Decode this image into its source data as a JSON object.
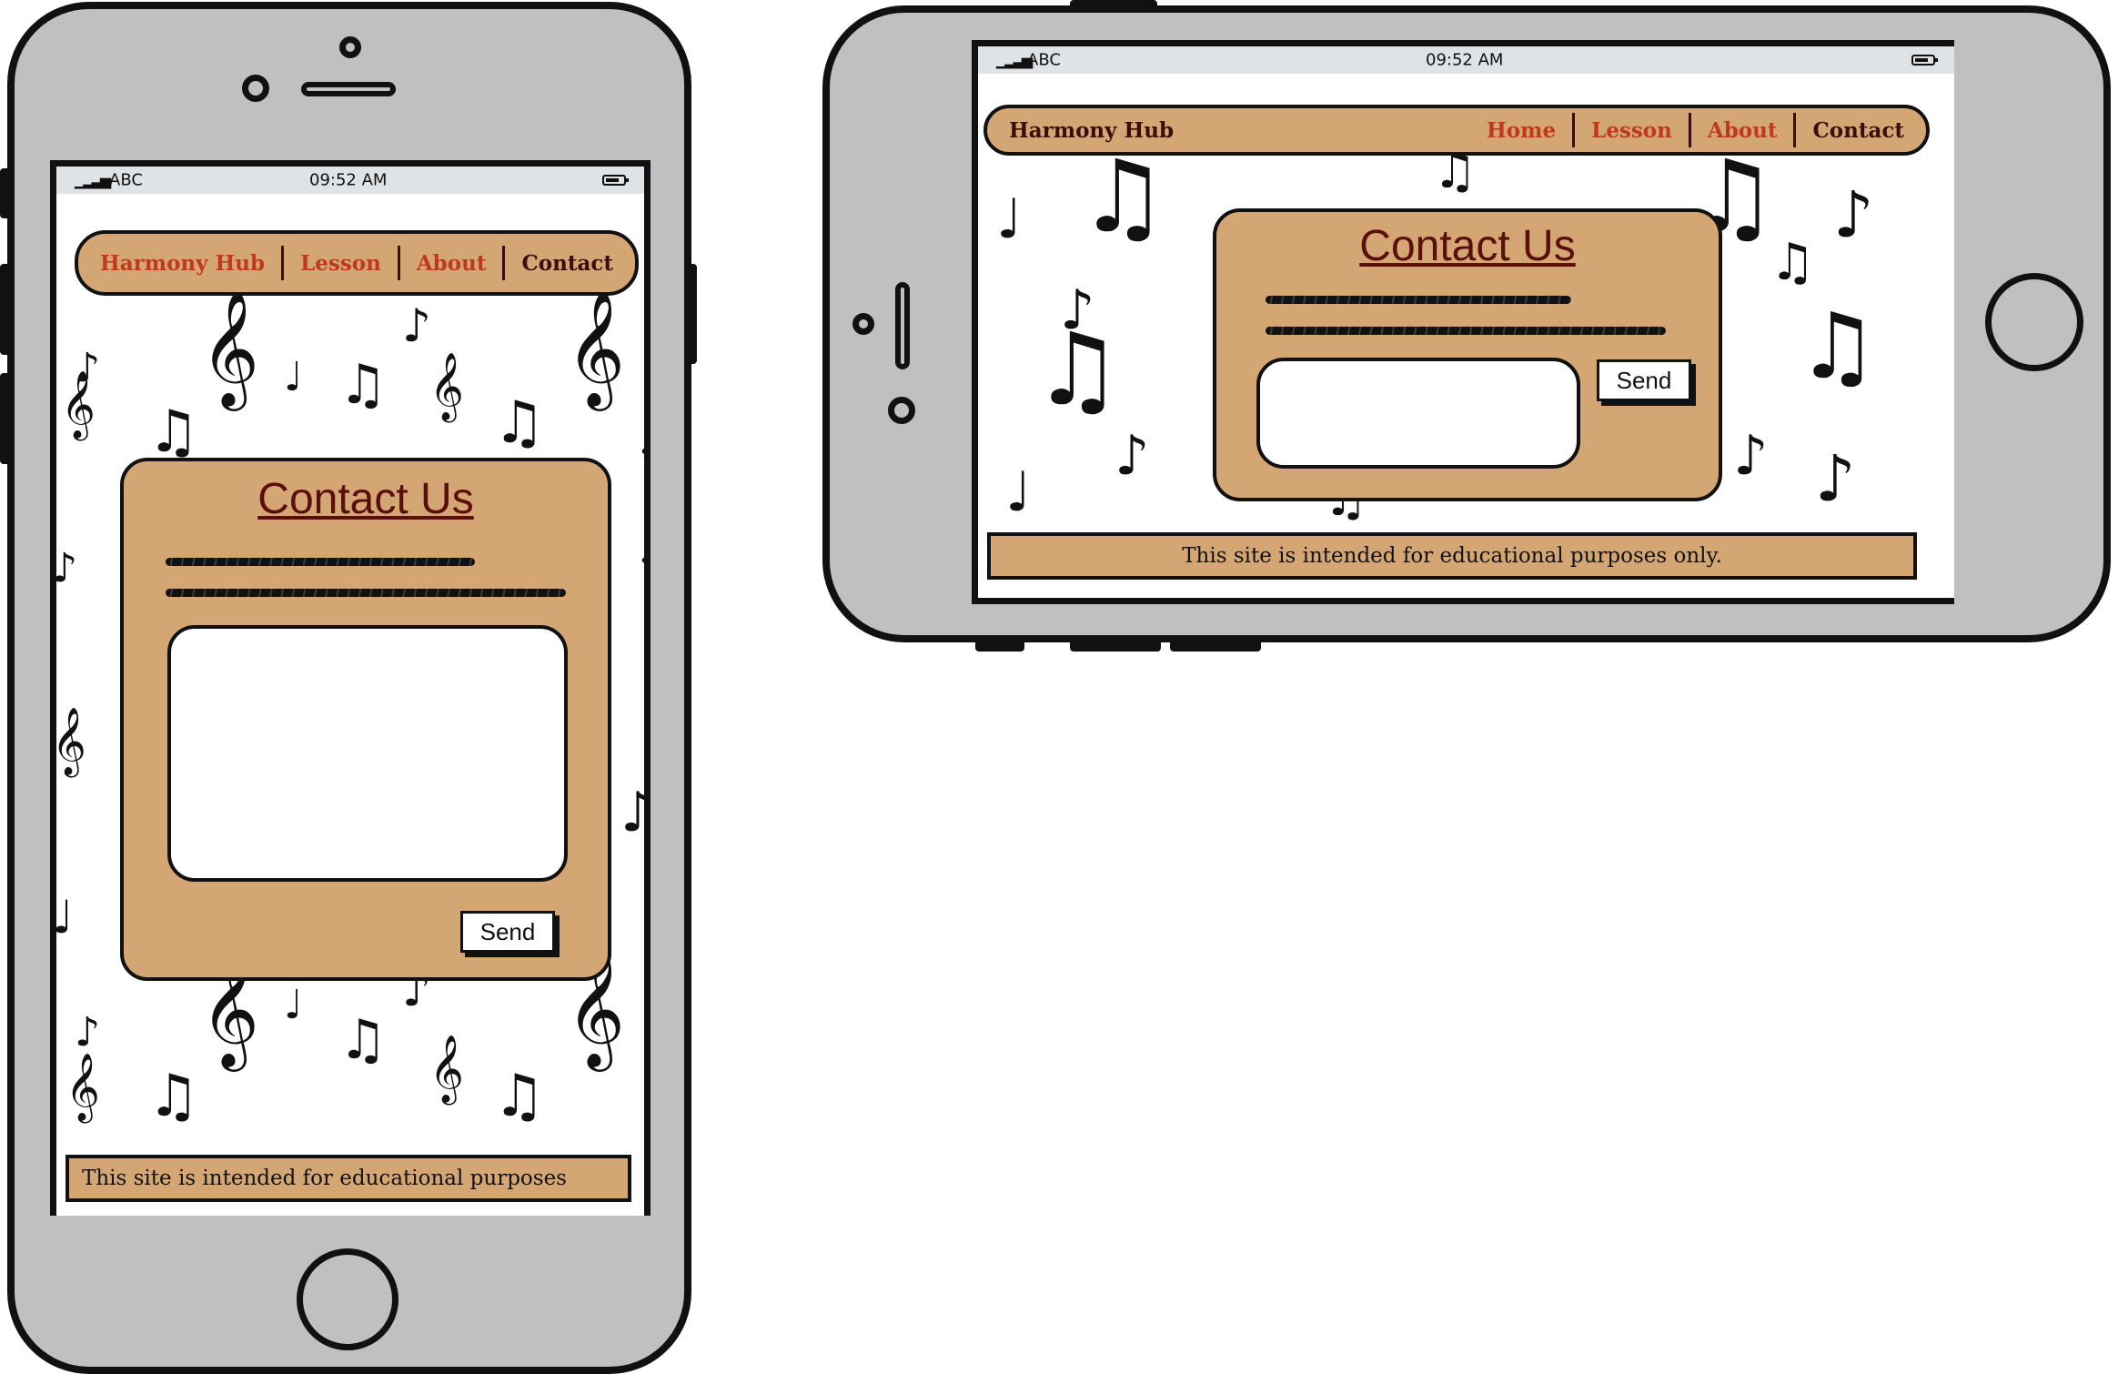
{
  "status_bar": {
    "carrier": "ABC",
    "time": "09:52 AM"
  },
  "nav": {
    "brand": "Harmony Hub",
    "portrait_links": [
      "Lesson",
      "About"
    ],
    "landscape_links": [
      "Home",
      "Lesson",
      "About"
    ],
    "active": "Contact"
  },
  "contact": {
    "title": "Contact Us",
    "send_label": "Send"
  },
  "footer": {
    "portrait_text": "This site is intended for educational purposes",
    "landscape_text": "This site is intended for educational purposes only."
  },
  "colors": {
    "panel": "#d4a674",
    "brand_text": "#3a0d06",
    "link": "#c0391b",
    "title": "#5a0f0d",
    "shell": "#c0c0c0"
  },
  "icons": [
    "signal-icon",
    "battery-icon",
    "music-note-icon",
    "treble-clef-icon",
    "home-button-icon",
    "camera-icon",
    "speaker-icon"
  ]
}
